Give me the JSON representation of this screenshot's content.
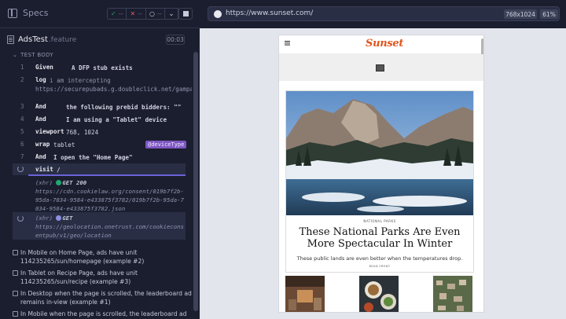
{
  "runner": {
    "title": "Specs",
    "stats": {
      "passed": "--",
      "failed": "--",
      "pending": "--"
    },
    "spec_file": "AdsTest",
    "spec_ext": ".feature",
    "timer": "00:03",
    "section": "TEST BODY"
  },
  "commands": [
    {
      "num": "1",
      "name": "Given",
      "message": "A DFP stub exists"
    },
    {
      "num": "2",
      "name": "log",
      "message": "i am intercepting https://securepubads.g.doubleclick.net/gampad/**"
    },
    {
      "num": "3",
      "name": "And",
      "message": "the following prebid bidders: \"\""
    },
    {
      "num": "4",
      "name": "And",
      "message": "I am using a \"Tablet\" device"
    },
    {
      "num": "5",
      "name": "viewport",
      "message": "768, 1024"
    },
    {
      "num": "6",
      "name": "wrap",
      "message": "tablet",
      "tag": "@deviceType"
    },
    {
      "num": "7",
      "name": "And",
      "message": "I open the \"Home Page\""
    },
    {
      "num": "",
      "name": "visit",
      "message": "/"
    }
  ],
  "requests": [
    {
      "prefix": "(xhr)",
      "status": "GET 200",
      "url": "https://cdn.cookielaw.org/consent/019b7f2b-95da-7034-9584-e433875f3782/019b7f2b-95da-7034-9584-e433875f3782.json"
    },
    {
      "prefix": "(xhr)",
      "status": "GET",
      "url": "https://geolocation.onetrust.com/cookieconsentpub/v1/geo/location"
    }
  ],
  "tests": [
    "In Mobile on Home Page, ads have unit 114235265/sun/homepage (example #2)",
    "In Tablet on Recipe Page, ads have unit 114235265/sun/recipe (example #3)",
    "In Desktop when the page is scrolled, the leaderboard ad remains in-view (example #1)",
    "In Mobile when the page is scrolled, the leaderboard ad"
  ],
  "browser": {
    "url": "https://www.sunset.com/",
    "viewport": "768x1024",
    "zoom": "61%"
  },
  "site": {
    "logo": "Sunset",
    "eyebrow": "NATIONAL PARKS",
    "headline": "These National Parks Are Even More Spectacular In Winter",
    "dek": "These public lands are even better when the temperatures drop.",
    "read_more": "READ FRONT"
  },
  "colors": {
    "bg_dark": "#1b1e2e",
    "pass": "#1fa971",
    "fail": "#e45770",
    "accent": "#6a63d8",
    "tag": "#7e57c2",
    "logo": "#e0541b"
  }
}
